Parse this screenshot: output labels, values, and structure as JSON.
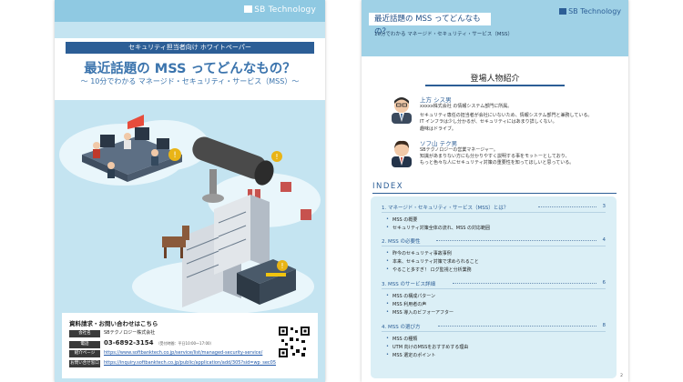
{
  "cover": {
    "brand": "SB Technology",
    "tag": "セキュリティ担当者向け ホワイトペーパー",
    "title": "最近話題の MSS ってどんなもの？",
    "subtitle": "〜 10分でわかる マネージド・セキュリティ・サービス（MSS）〜",
    "contact": {
      "heading": "資料請求・お問い合わせはこちら",
      "rows": [
        {
          "label": "会社名",
          "value": "SBテクノロジー株式会社"
        },
        {
          "label": "電話",
          "value": "03-6892-3154",
          "note": "（受付時間：平日10:00〜17:00）"
        },
        {
          "label": "紹介ページ",
          "value": "https://www.softbanktech.co.jp/service/list/managed-security-service/"
        },
        {
          "label": "お問い合せ窓口",
          "value": "https://inquiry.softbanktech.co.jp/public/application/add/305?sid=wp_sec05"
        }
      ]
    }
  },
  "index_page": {
    "brand": "SB Technology",
    "header_title": "最近話題の MSS ってどんなもの？",
    "header_subtitle": "10分でわかる マネージド・セキュリティ・サービス（MSS）",
    "characters_heading": "登場人物紹介",
    "characters": [
      {
        "name": "上方 シス男",
        "lines": [
          "xxxxx株式会社 の情報システム部門に所属。",
          "セキュリティ専任の担当者が会社にいないため、情報システム部門と兼務している。",
          "IT インフラは少し分かるが、セキュリティにはあまり詳しくない。",
          "趣味はドライブ。"
        ]
      },
      {
        "name": "ソフ山 テク男",
        "lines": [
          "SBテクノロジーの営業マネージャー。",
          "知識があまりない方にも分かりやすく説明する事をモットーとしており、",
          "もっと色々な人にセキュリティ対策の重要性を知ってほしいと思っている。"
        ]
      }
    ],
    "index_heading": "INDEX",
    "sections": [
      {
        "title": "1. マネージド・セキュリティ・サービス（MSS）とは？",
        "page": "3",
        "items": [
          "MSS の概要",
          "セキュリティ対策全体の流れ、MSS の対応範囲"
        ]
      },
      {
        "title": "2. MSS の必要性",
        "page": "4",
        "items": [
          "昨今のセキュリティ事故事例",
          "本来、セキュリティ対策で求められること",
          "やること多すぎ！ ログ監視と分析業務"
        ]
      },
      {
        "title": "3. MSS のサービス詳細",
        "page": "6",
        "items": [
          "MSS の構成パターン",
          "MSS 利用者の声",
          "MSS 導入のビフォーアフター"
        ]
      },
      {
        "title": "4. MSS の選び方",
        "page": "8",
        "items": [
          "MSS の種類",
          "UTM 向けのMSSをおすすめする理由",
          "MSS 選定のポイント"
        ]
      }
    ],
    "page_number": "2"
  }
}
